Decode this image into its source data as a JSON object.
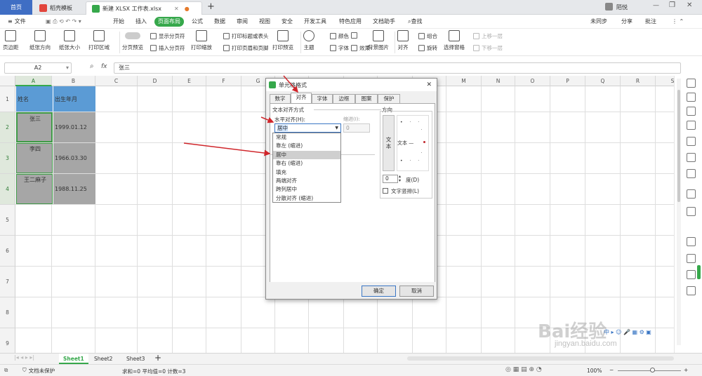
{
  "tabs": {
    "home": "首页",
    "template": "稻壳模板",
    "file": "新建 XLSX 工作表.xlsx",
    "add": "+",
    "user": "陌悦"
  },
  "menu": {
    "file": "文件",
    "items": [
      "开始",
      "插入",
      "页面布局",
      "公式",
      "数据",
      "审阅",
      "视图",
      "安全",
      "开发工具",
      "特色应用",
      "文档助手"
    ],
    "search": "查找",
    "sync": "未同步",
    "share": "分享",
    "comment": "批注"
  },
  "ribbon": {
    "big": [
      "页边距",
      "纸张方向",
      "纸张大小",
      "打印区域",
      "分页预览",
      "打印缩放",
      "打印预览",
      "主题",
      "对齐",
      "旋转",
      "选择窗格"
    ],
    "small": [
      "显示分页符",
      "插入分页符",
      "打印标题或表头",
      "打印页眉和页脚",
      "颜色",
      "字体",
      "效果",
      "背景图片",
      "组合",
      "上移一层",
      "下移一层"
    ]
  },
  "formula": {
    "cell_ref": "A2",
    "fx": "fx",
    "content": "张三"
  },
  "columns": [
    "A",
    "B",
    "C",
    "D",
    "E",
    "F",
    "G",
    "H",
    "I",
    "J",
    "K",
    "L",
    "M",
    "N",
    "O",
    "P",
    "Q",
    "R",
    "S"
  ],
  "rows": [
    "1",
    "2",
    "3",
    "4",
    "5",
    "6",
    "7",
    "8",
    "9"
  ],
  "table": {
    "h1": "姓名",
    "h2": "出生年月",
    "names": [
      "张三",
      "李四",
      "王二麻子"
    ],
    "dates": [
      "1999.01.12",
      "1966.03.30",
      "1988.11.25"
    ]
  },
  "sheets": {
    "s1": "Sheet1",
    "s2": "Sheet2",
    "s3": "Sheet3",
    "add": "+"
  },
  "status": {
    "protect": "文档未保护",
    "stats": "求和=0  平均值=0  计数=3",
    "zoom": "100%"
  },
  "dialog": {
    "title": "单元格格式",
    "tabs": [
      "数字",
      "对齐",
      "字体",
      "边框",
      "图案",
      "保护"
    ],
    "section": "文本对齐方式",
    "h_align_label": "水平对齐(H):",
    "h_align_value": "居中",
    "indent_label": "缩进(I):",
    "indent_value": "0",
    "direction_label": "方向",
    "text_vertical": "文本",
    "text_label": "文本 —",
    "degree_value": "0",
    "degree_label": "度(D)",
    "vertical_text": "文字竖排(L)",
    "options": [
      "常规",
      "靠左 (缩进)",
      "居中",
      "靠右 (缩进)",
      "填充",
      "两端对齐",
      "跨列居中",
      "分散对齐 (缩进)"
    ],
    "ok": "确定",
    "cancel": "取消"
  },
  "watermark": {
    "text": "Bai经验",
    "url": "jingyan.baidu.com"
  },
  "colors": {
    "accent": "#36a84b",
    "header_fill": "#5b9bd5",
    "cell_fill": "#a6a6a6",
    "arrow": "#d0262b"
  }
}
